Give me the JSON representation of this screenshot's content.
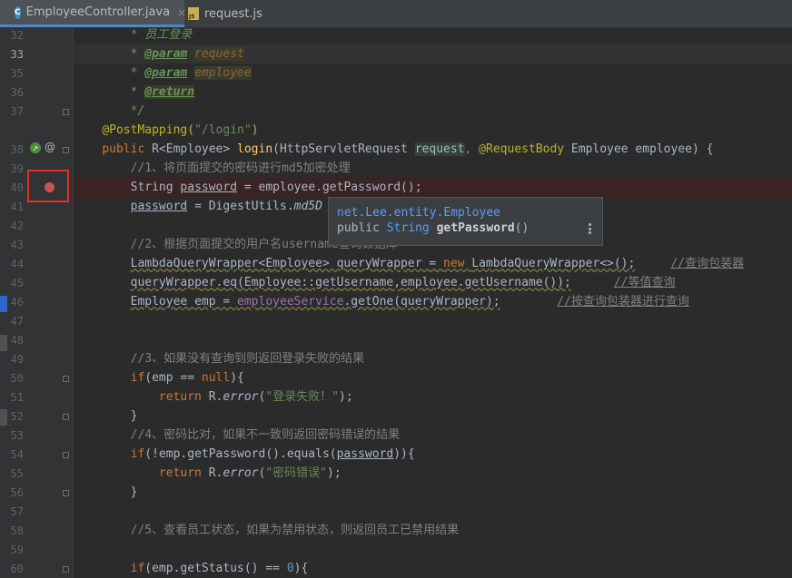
{
  "tabs": [
    {
      "label": "EmployeeController.java",
      "icon": "java-class-icon",
      "active": true
    },
    {
      "label": "request.js",
      "icon": "js-file-icon",
      "active": false
    }
  ],
  "gutter": {
    "line_numbers": [
      "32",
      "33",
      "35",
      "36",
      "37",
      "38",
      "39",
      "40",
      "41",
      "42",
      "43",
      "44",
      "45",
      "46",
      "47",
      "48",
      "49",
      "50",
      "51",
      "52",
      "53",
      "54",
      "55",
      "56",
      "57",
      "58",
      "59",
      "60"
    ]
  },
  "code": {
    "l32_text": "* 员工登录",
    "l33_star": "* ",
    "l33_tag": "@param",
    "l33_name": "request",
    "l35_star": "* ",
    "l35_tag": "@param",
    "l35_name": "employee",
    "l36_star": "* ",
    "l36_tag": "@return",
    "l37_text": "*/",
    "l38_anno": "@PostMapping(",
    "l38_str": "\"/login\"",
    "l38_end": ")",
    "l39_kw": "public ",
    "l39_type": "R<Employee> ",
    "l39_fn": "login",
    "l39_p1": "(HttpServletRequest ",
    "l39_p1name": "request",
    "l39_comma": ", ",
    "l39_anno": "@RequestBody ",
    "l39_rest": "Employee employee) {",
    "l40_cmt": "//1、将页面提交的密码进行md5加密处理",
    "l41_a": "String ",
    "l41_var": "password",
    "l41_b": " = employee.getPassword();",
    "l42_var": "password",
    "l42_b": " = DigestUtils.",
    "l42_fn": "md5D",
    "l44_cmt": "//2、根据页面提交的用户名username查询数据库",
    "l45_a": "LambdaQueryWrapper<Employee> queryWrapper = ",
    "l45_kw": "new ",
    "l45_b": "LambdaQueryWrapper<>();",
    "l45_cmt": "//查询包装器",
    "l46_a": "queryWrapper.eq(Employee::getUsername,employee.getUsername());",
    "l46_cmt": "//等值查询",
    "l47_a": "Employee emp = ",
    "l47_fld": "employeeService",
    "l47_b": ".getOne(queryWrapper);",
    "l47_cmt": "//按查询包装器进行查询",
    "l50_cmt": "//3、如果没有查询到则返回登录失败的结果",
    "l51_kw": "if",
    "l51_a": "(emp == ",
    "l51_null": "null",
    "l51_b": "){",
    "l52_kw": "return ",
    "l52_a": "R.",
    "l52_fn": "error",
    "l52_str": "\"登录失败！\"",
    "l52_b": ");",
    "l52_open": "(",
    "l53_text": "}",
    "l54_cmt": "//4、密码比对，如果不一致则返回密码错误的结果",
    "l55_kw": "if",
    "l55_a": "(!emp.getPassword().equals(",
    "l55_var": "password",
    "l55_b": ")){",
    "l56_kw": "return ",
    "l56_a": "R.",
    "l56_fn": "error",
    "l56_open": "(",
    "l56_str": "\"密码错误\"",
    "l56_b": ");",
    "l57_text": "}",
    "l59_cmt": "//5、查看员工状态，如果为禁用状态，则返回员工已禁用结果",
    "l60_kw": "if",
    "l60_a": "(emp.getStatus() == ",
    "l60_num": "0",
    "l60_b": "){"
  },
  "popup": {
    "line1": "net.Lee.entity.Employee",
    "line2_kw": "public ",
    "line2_type": "String ",
    "line2_fn": "getPassword",
    "line2_end": "()"
  },
  "colors": {
    "background": "#2b2b2b",
    "gutter": "#313335",
    "breakpoint": "#c75450",
    "highlight_box": "#e0302c"
  }
}
